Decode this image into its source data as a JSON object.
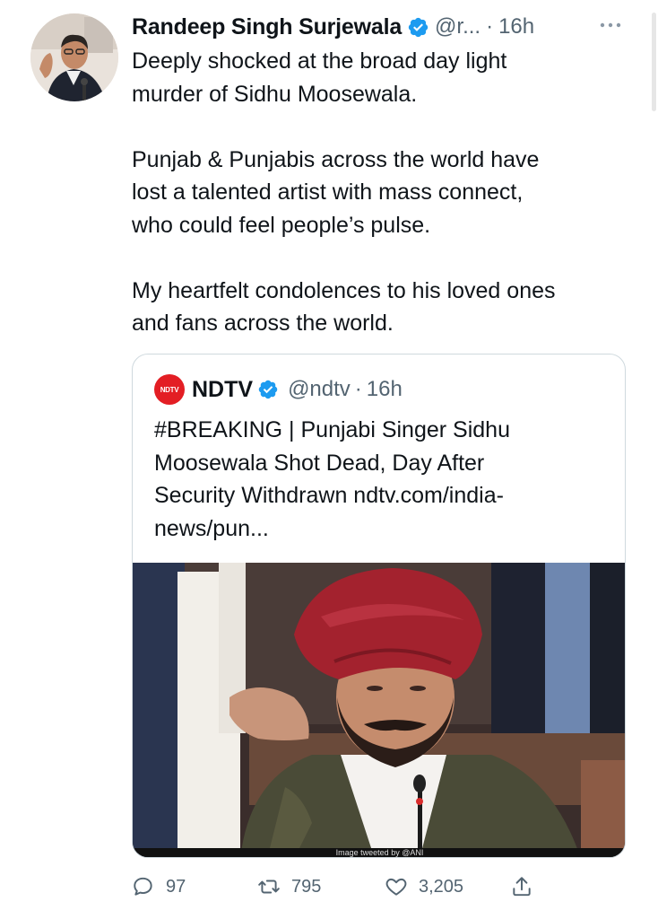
{
  "tweet": {
    "author_name": "Randeep Singh Surjewala",
    "handle": "@r...",
    "separator": "·",
    "time": "16h",
    "text": "Deeply shocked at the broad day light\nmurder of Sidhu Moosewala.\n\nPunjab & Punjabis across the world have\nlost a talented artist with mass connect,\nwho could feel people’s pulse.\n\nMy heartfelt condolences to his loved ones\nand fans across the world."
  },
  "quoted": {
    "logo_text": "NDTV",
    "author_name": "NDTV",
    "handle": "@ndtv",
    "separator": "·",
    "time": "16h",
    "text": "#BREAKING | Punjabi Singer Sidhu\nMoosewala Shot Dead, Day After\nSecurity Withdrawn ndtv.com/india-\nnews/pun...",
    "media_caption": "Image tweeted by @ANI"
  },
  "actions": {
    "reply_count": "97",
    "retweet_count": "795",
    "like_count": "3,205"
  },
  "icons": {
    "verified": "verified-badge-icon",
    "more": "more-dots-icon",
    "reply": "reply-bubble-icon",
    "retweet": "retweet-icon",
    "like": "heart-icon",
    "share": "share-upload-icon"
  },
  "colors": {
    "verified_blue": "#1d9bf0",
    "secondary_text": "#536471",
    "ndtv_red": "#e31e24",
    "turban_maroon": "#a3222e"
  }
}
